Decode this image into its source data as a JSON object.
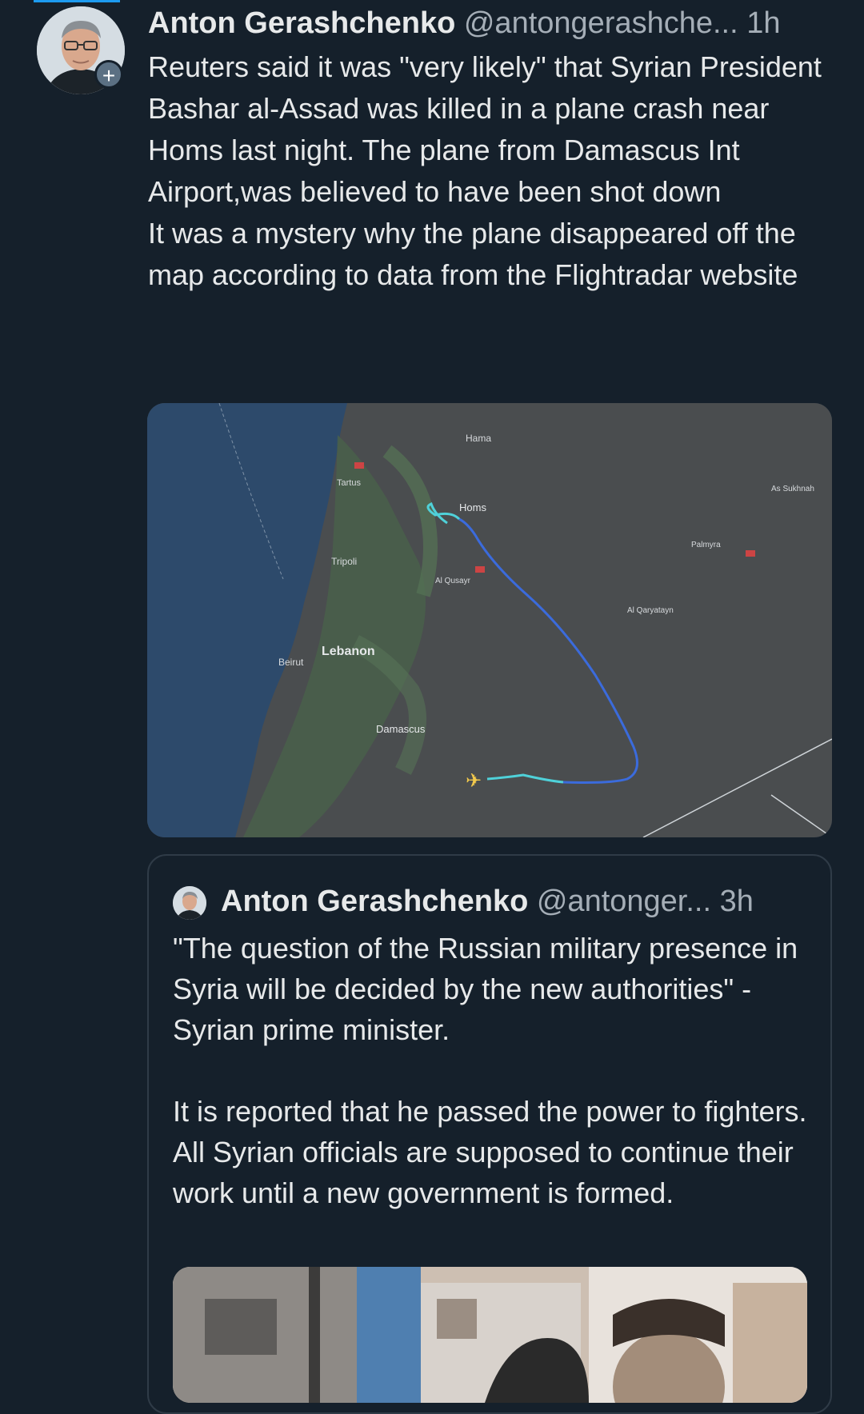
{
  "tweet": {
    "author_name": "Anton Gerashchenko",
    "handle": "@antongerashche...",
    "separator": "",
    "time": "1h",
    "text": "Reuters said it was \"very likely\" that Syrian President Bashar al-Assad was killed in a plane crash near Homs last night. The plane from Damascus Int Airport,was believed to have been shot down\nIt was a mystery why the plane disappeared off the map according to data from the Flightradar website",
    "follow_badge": "+"
  },
  "map": {
    "labels": {
      "hama": "Hama",
      "homs": "Homs",
      "tartus": "Tartus",
      "tripoli": "Tripoli",
      "lebanon": "Lebanon",
      "beirut": "Beirut",
      "damascus": "Damascus",
      "al_qusayr": "Al Qusayr",
      "palmyra": "Palmyra",
      "al_sukhnah": "As Sukhnah",
      "al_qaryatayn": "Al Qaryatayn"
    },
    "colors": {
      "sea": "#2d4a6b",
      "land": "#4a4d4f",
      "mountains": "#49604a",
      "flight_path": "#3b6bdc",
      "flight_path_start": "#4fd1d9",
      "plane": "#f2c94c"
    }
  },
  "quoted_tweet": {
    "author_name": "Anton Gerashchenko",
    "handle": "@antonger...",
    "time": "3h",
    "text": "\"The question of the Russian military presence in Syria will be decided by the new authorities\" - Syrian prime minister.\n\nIt is reported that he passed the power to fighters. All Syrian officials are supposed to continue their work until a new government is formed."
  }
}
